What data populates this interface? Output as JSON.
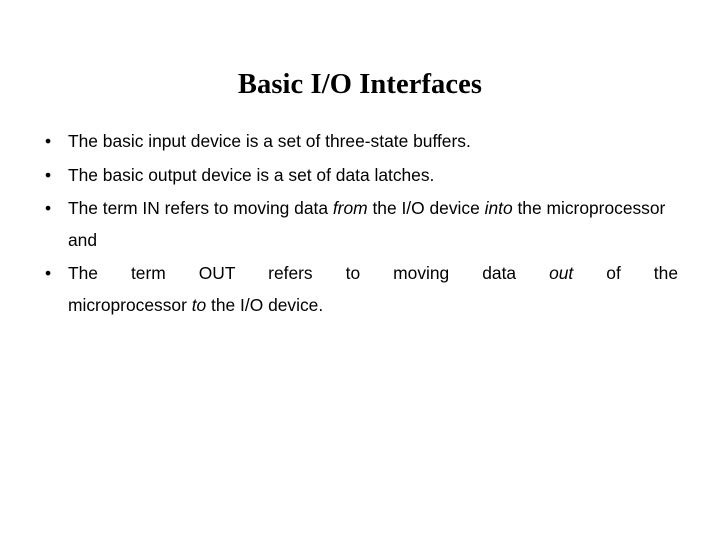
{
  "slide": {
    "title": "Basic I/O Interfaces",
    "bullet_marker": "•",
    "bullets": [
      {
        "id": "bullet-input-device",
        "text": "The basic input device is a set of three-state buffers."
      },
      {
        "id": "bullet-output-device",
        "text": "The basic output device is a set of data latches."
      },
      {
        "id": "bullet-term-in",
        "segments": {
          "part1": "The term IN refers to moving data ",
          "italic1": "from",
          "part2": " the I/O device ",
          "italic2": "into",
          "part3": " the microprocessor and"
        }
      },
      {
        "id": "bullet-term-out",
        "segments": {
          "line_a_part1": "The term OUT refers to moving data ",
          "line_a_italic": "out",
          "line_a_part2": " of the",
          "line_b_part1": "microprocessor ",
          "line_b_italic": "to",
          "line_b_part2": " the I/O device."
        }
      }
    ]
  },
  "colors": {
    "background": "#ffffff",
    "text": "#000000"
  }
}
